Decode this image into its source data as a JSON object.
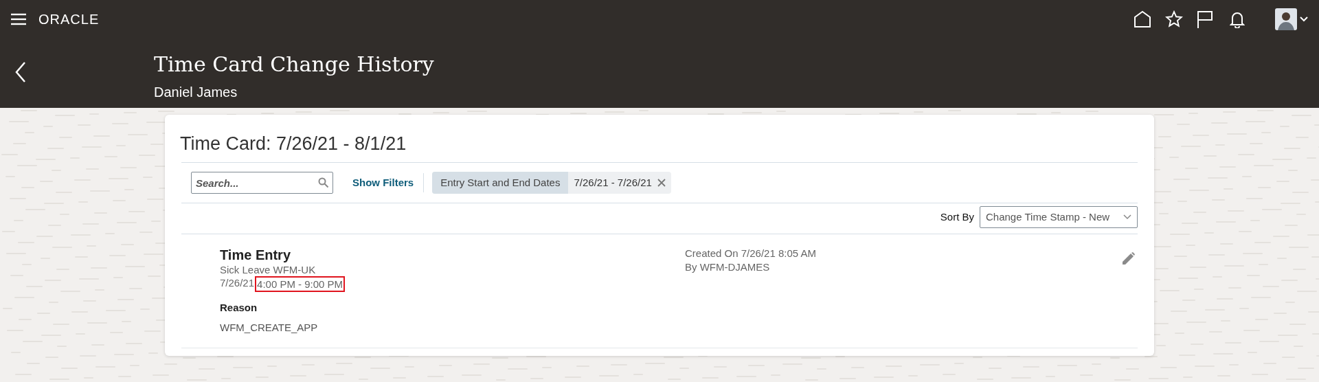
{
  "top_bar": {
    "logo": "ORACLE"
  },
  "header": {
    "title": "Time Card Change History",
    "subtitle": "Daniel James"
  },
  "card": {
    "title": "Time Card: 7/26/21 - 8/1/21",
    "search": {
      "placeholder": "Search..."
    },
    "show_filters": "Show Filters",
    "filter_chip": {
      "label": "Entry Start and End Dates",
      "value": "7/26/21 - 7/26/21"
    },
    "sort": {
      "label": "Sort By",
      "value": "Change Time Stamp - New"
    },
    "entries": [
      {
        "title": "Time Entry",
        "type": "Sick Leave WFM-UK",
        "date": "7/26/21",
        "time": "4:00 PM - 9:00 PM",
        "time_highlighted": true,
        "reason_label": "Reason",
        "reason": "WFM_CREATE_APP",
        "created": "Created On 7/26/21 8:05 AM",
        "by": "By WFM-DJAMES"
      }
    ]
  }
}
